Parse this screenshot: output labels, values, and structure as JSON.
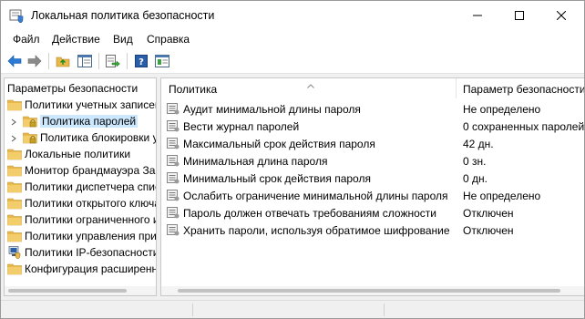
{
  "window": {
    "title": "Локальная политика безопасности",
    "icon": "shield-policy-icon"
  },
  "menu": [
    "Файл",
    "Действие",
    "Вид",
    "Справка"
  ],
  "toolbar": {
    "buttons": [
      "back-icon",
      "forward-icon",
      "up-folder-icon",
      "show-hide-tree-icon",
      "export-list-icon",
      "help-icon",
      "properties-icon"
    ]
  },
  "tree": {
    "root": "Параметры безопасности",
    "items": [
      {
        "label": "Политики учетных записей",
        "level": 1,
        "expanded": true,
        "icon": "folder-icon"
      },
      {
        "label": "Политика паролей",
        "level": 2,
        "selected": true,
        "icon": "folder-lock-icon"
      },
      {
        "label": "Политика блокировки учетной записи",
        "level": 2,
        "icon": "folder-lock-icon"
      },
      {
        "label": "Локальные политики",
        "level": 1,
        "icon": "folder-icon"
      },
      {
        "label": "Монитор брандмауэра Защитника Windows",
        "level": 1,
        "icon": "folder-icon"
      },
      {
        "label": "Политики диспетчера списков сетей",
        "level": 1,
        "icon": "folder-icon"
      },
      {
        "label": "Политики открытого ключа",
        "level": 1,
        "icon": "folder-icon"
      },
      {
        "label": "Политики ограниченного использования программ",
        "level": 1,
        "icon": "folder-icon"
      },
      {
        "label": "Политики управления приложениями",
        "level": 1,
        "icon": "folder-icon"
      },
      {
        "label": "Политики IP-безопасности",
        "level": 1,
        "icon": "ip-security-icon"
      },
      {
        "label": "Конфигурация расширенной политики аудита",
        "level": 1,
        "icon": "folder-icon"
      }
    ]
  },
  "list": {
    "columns": [
      "Политика",
      "Параметр безопасности"
    ],
    "rows": [
      {
        "policy": "Аудит минимальной длины пароля",
        "value": "Не определено"
      },
      {
        "policy": "Вести журнал паролей",
        "value": "0 сохраненных паролей"
      },
      {
        "policy": "Максимальный срок действия пароля",
        "value": "42 дн."
      },
      {
        "policy": "Минимальная длина пароля",
        "value": "0 зн."
      },
      {
        "policy": "Минимальный срок действия пароля",
        "value": "0 дн."
      },
      {
        "policy": "Ослабить ограничение минимальной длины пароля",
        "value": "Не определено"
      },
      {
        "policy": "Пароль должен отвечать требованиям сложности",
        "value": "Отключен"
      },
      {
        "policy": "Хранить пароли, используя обратимое шифрование",
        "value": "Отключен"
      }
    ]
  },
  "colors": {
    "selection": "#cce8ff",
    "folder": "#e8b84a",
    "help": "#2a5ea8",
    "nav-arrow": "#2a7ad6"
  }
}
